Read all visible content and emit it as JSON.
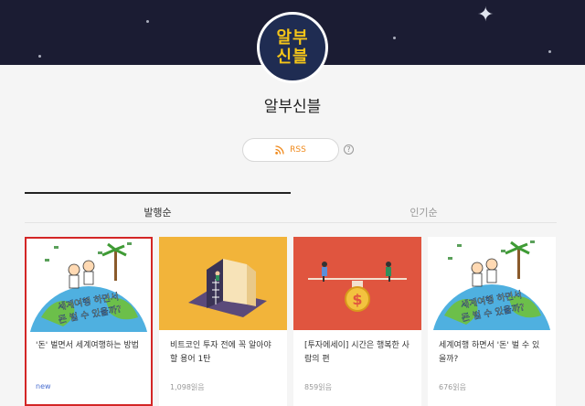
{
  "blog": {
    "logo_line1": "알부",
    "logo_line2": "신블",
    "title": "알부신블",
    "rss_label": "RSS",
    "help_glyph": "?"
  },
  "tabs": [
    {
      "label": "발행순",
      "active": true
    },
    {
      "label": "인기순",
      "active": false
    }
  ],
  "posts": [
    {
      "title": "'돈' 벌면서 세계여행하는 방법",
      "meta": "new",
      "thumb_text1": "세계여행 하면서",
      "thumb_text2": "돈 벌 수 있을까?"
    },
    {
      "title": "비트코인 투자 전에 꼭 알아야 할 용어 1탄",
      "meta": "1,098읽음"
    },
    {
      "title": "[투자에세이] 시간은 행복한 사람의 편",
      "meta": "859읽음"
    },
    {
      "title": "세계여행 하면서 '돈' 벌 수 있을까?",
      "meta": "676읽음",
      "thumb_text1": "세계여행 하면서",
      "thumb_text2": "돈 벌 수 있을까?"
    }
  ],
  "colors": {
    "banner": "#1b1c33",
    "logo_bg": "#1f2c52",
    "logo_text": "#f5c518",
    "rss": "#f08a1c",
    "selected_border": "#d32626",
    "thumb_yellow": "#f2b43a",
    "thumb_red": "#e0553f"
  }
}
